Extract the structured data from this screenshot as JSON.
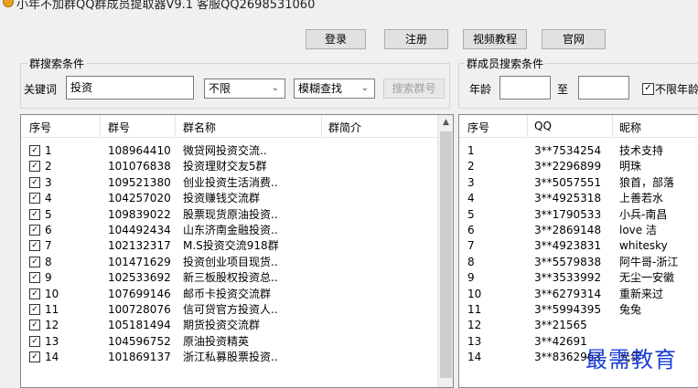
{
  "title": "小年不加群QQ群成员提取器V9.1   客服QQ2698531060",
  "toolbar": {
    "login": "登录",
    "register": "注册",
    "video_tutorial": "视频教程",
    "official_site": "官网"
  },
  "group_search": {
    "section_title": "群搜索条件",
    "keyword_label": "关键词",
    "keyword_value": "投资",
    "type_select": "不限",
    "mode_select": "模糊查找",
    "search_button": "搜索群号"
  },
  "member_search": {
    "section_title": "群成员搜索条件",
    "age_label": "年龄",
    "to_label": "至",
    "age_from": "",
    "age_to": "",
    "no_age_limit_label": "不限年龄",
    "no_age_limit_checked": true
  },
  "group_table": {
    "headers": [
      "序号",
      "群号",
      "群名称",
      "群简介"
    ],
    "rows": [
      {
        "no": "1",
        "id": "108964410",
        "name": "微贷网投资交流..",
        "checked": true
      },
      {
        "no": "2",
        "id": "101076838",
        "name": "投资理财交友5群",
        "checked": true
      },
      {
        "no": "3",
        "id": "109521380",
        "name": "创业投资生活消费..",
        "checked": true
      },
      {
        "no": "4",
        "id": "104257020",
        "name": "投资赚钱交流群",
        "checked": true
      },
      {
        "no": "5",
        "id": "109839022",
        "name": "股票现货原油投资..",
        "checked": true
      },
      {
        "no": "6",
        "id": "104492434",
        "name": " 山东济南金融投资..",
        "checked": true
      },
      {
        "no": "7",
        "id": "102132317",
        "name": " M.S投资交流918群",
        "checked": true
      },
      {
        "no": "8",
        "id": "101471629",
        "name": "投资创业项目现货..",
        "checked": true
      },
      {
        "no": "9",
        "id": "102533692",
        "name": " 新三板股权投资总..",
        "checked": true
      },
      {
        "no": "10",
        "id": "107699146",
        "name": " 邮币卡投资交流群",
        "checked": true
      },
      {
        "no": "11",
        "id": "100728076",
        "name": " 信可贷官方投资人..",
        "checked": true
      },
      {
        "no": "12",
        "id": "105181494",
        "name": "期货投资交流群",
        "checked": true
      },
      {
        "no": "13",
        "id": "104596752",
        "name": "原油投资精英",
        "checked": true
      },
      {
        "no": "14",
        "id": "101869137",
        "name": "浙江私募股票投资..",
        "checked": true
      }
    ]
  },
  "member_table": {
    "headers": [
      "序号",
      "QQ",
      "昵称"
    ],
    "rows": [
      {
        "no": "1",
        "qq": "3**7534254",
        "nick": "技术支持"
      },
      {
        "no": "2",
        "qq": "3**2296899",
        "nick": "明珠"
      },
      {
        "no": "3",
        "qq": "3**5057551",
        "nick": "狼首，部落"
      },
      {
        "no": "4",
        "qq": "3**4925318",
        "nick": "上善若水"
      },
      {
        "no": "5",
        "qq": "3**1790533",
        "nick": "小兵-南昌"
      },
      {
        "no": "6",
        "qq": "3**2869148",
        "nick": "love 洁"
      },
      {
        "no": "7",
        "qq": "3**4923831",
        "nick": "whitesky"
      },
      {
        "no": "8",
        "qq": "3**5579838",
        "nick": "阿牛哥-浙江"
      },
      {
        "no": "9",
        "qq": "3**3533992",
        "nick": "无尘一安徽"
      },
      {
        "no": "10",
        "qq": "3**6279314",
        "nick": "重新来过"
      },
      {
        "no": "11",
        "qq": "3**5994395",
        "nick": "兔兔"
      },
      {
        "no": "12",
        "qq": "3**21565",
        "nick": ""
      },
      {
        "no": "13",
        "qq": "3**42691",
        "nick": ""
      },
      {
        "no": "14",
        "qq": "3**8362963",
        "nick": "光年"
      }
    ]
  },
  "watermark": "最需教育"
}
